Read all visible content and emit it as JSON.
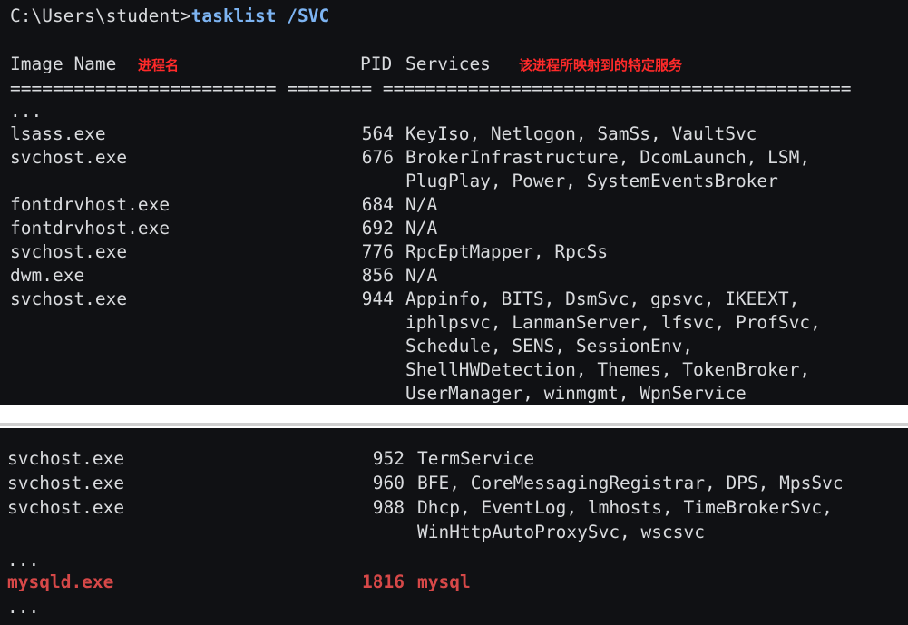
{
  "command": {
    "prompt": "C:\\Users\\student>",
    "text": "tasklist /SVC"
  },
  "header": {
    "image_name": "Image Name",
    "pid": "PID",
    "services": "Services",
    "anno_process": "进程名",
    "anno_services": "该进程所映射到的特定服务",
    "separator": "========================= ======== ============================================"
  },
  "panel1": {
    "ellipsis_top": "...",
    "rows": [
      {
        "image": "lsass.exe",
        "pid": "564",
        "services": [
          "KeyIso, Netlogon, SamSs, VaultSvc"
        ]
      },
      {
        "image": "svchost.exe",
        "pid": "676",
        "services": [
          "BrokerInfrastructure, DcomLaunch, LSM,",
          "PlugPlay, Power, SystemEventsBroker"
        ]
      },
      {
        "image": "fontdrvhost.exe",
        "pid": "684",
        "services": [
          "N/A"
        ]
      },
      {
        "image": "fontdrvhost.exe",
        "pid": "692",
        "services": [
          "N/A"
        ]
      },
      {
        "image": "svchost.exe",
        "pid": "776",
        "services": [
          "RpcEptMapper, RpcSs"
        ]
      },
      {
        "image": "dwm.exe",
        "pid": "856",
        "services": [
          "N/A"
        ]
      },
      {
        "image": "svchost.exe",
        "pid": "944",
        "services": [
          "Appinfo, BITS, DsmSvc, gpsvc, IKEEXT,",
          "iphlpsvc, LanmanServer, lfsvc, ProfSvc,",
          "Schedule, SENS, SessionEnv,",
          "ShellHWDetection, Themes, TokenBroker,",
          "UserManager, winmgmt, WpnService"
        ]
      }
    ]
  },
  "panel2": {
    "rows": [
      {
        "image": "svchost.exe",
        "pid": "952",
        "services": [
          "TermService"
        ]
      },
      {
        "image": "svchost.exe",
        "pid": "960",
        "services": [
          "BFE, CoreMessagingRegistrar, DPS, MpsSvc"
        ]
      },
      {
        "image": "svchost.exe",
        "pid": "988",
        "services": [
          "Dhcp, EventLog, lmhosts, TimeBrokerSvc,",
          "WinHttpAutoProxySvc, wscsvc"
        ]
      }
    ],
    "ellipsis_mid": "...",
    "highlight": {
      "image": "mysqld.exe",
      "pid": "1816",
      "services": "mysql"
    },
    "ellipsis_bottom": "...",
    "highlight_color": "#d64848"
  }
}
